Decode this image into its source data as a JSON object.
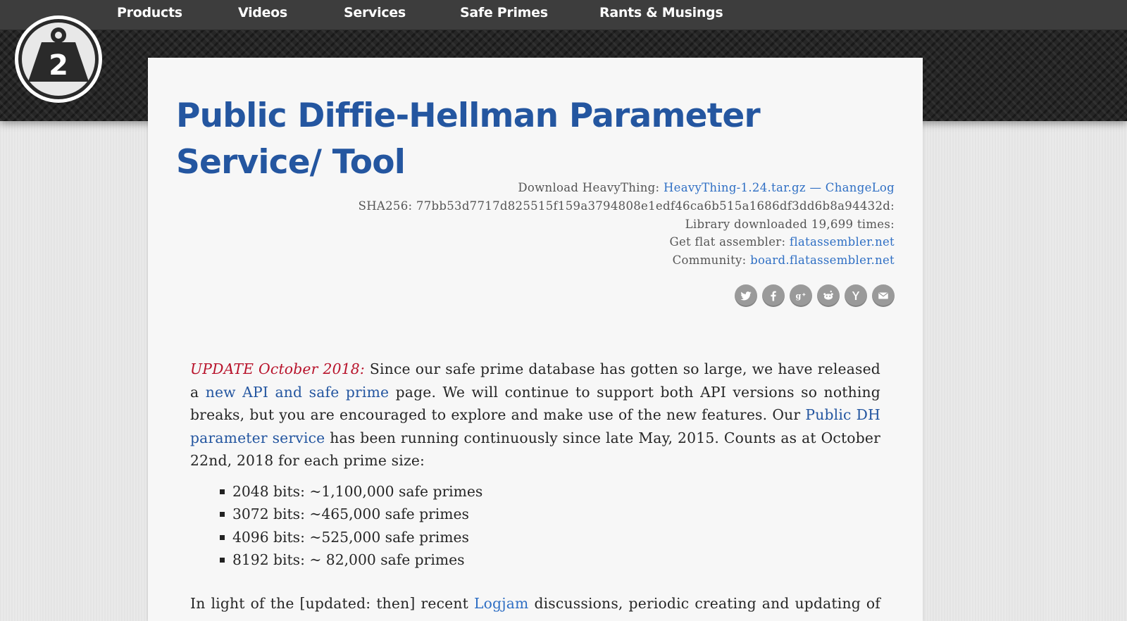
{
  "nav": {
    "items": [
      {
        "label": "Products"
      },
      {
        "label": "Videos"
      },
      {
        "label": "Services"
      },
      {
        "label": "Safe Primes"
      },
      {
        "label": "Rants & Musings"
      }
    ]
  },
  "logo": {
    "text": "2",
    "icon": "weight-logo-icon"
  },
  "page": {
    "title": "Public Diffie-Hellman Parameter Service/ Tool"
  },
  "info": {
    "download_prefix": "Download HeavyThing:",
    "download_link": "HeavyThing-1.24.tar.gz",
    "dash": "—",
    "changelog_link": "ChangeLog",
    "sha_line": "SHA256: 77bb53d7717d825515f159a3794808e1edf46ca6b515a1686df3dd6b8a94432d:",
    "downloads_line": "Library downloaded 19,699 times:",
    "fasm_prefix": "Get flat assembler:",
    "fasm_link": "flatassembler.net",
    "community_prefix": "Community:",
    "community_link": "board.flatassembler.net"
  },
  "social": [
    "twitter-icon",
    "facebook-icon",
    "google-plus-icon",
    "reddit-icon",
    "hacker-news-icon",
    "email-icon"
  ],
  "update": {
    "label": "UPDATE October 2018:",
    "text1": " Since our safe prime database has gotten so large, we have released a ",
    "link1": "new API and safe prime",
    "text2": " page. We will continue to support both API versions so nothing breaks, but you are encouraged to explore and make use of the new features. Our ",
    "link2": "Public DH parameter service",
    "text3": " has been running continuously since late May, 2015. Counts as at October 22nd, 2018 for each prime size:"
  },
  "counts": [
    "2048 bits: ~1,100,000 safe primes",
    "3072 bits: ~465,000 safe primes",
    "4096 bits: ~525,000 safe primes",
    "8192 bits: ~ 82,000 safe primes"
  ],
  "next_paragraph": {
    "text1": "In light of the [updated: then] recent ",
    "link": "Logjam",
    "text2": " discussions, periodic creating and updating of"
  },
  "colors": {
    "accent": "#2456a0",
    "link": "#2f6fc4",
    "update": "#b8132b",
    "navbar": "#3d3d3d"
  }
}
